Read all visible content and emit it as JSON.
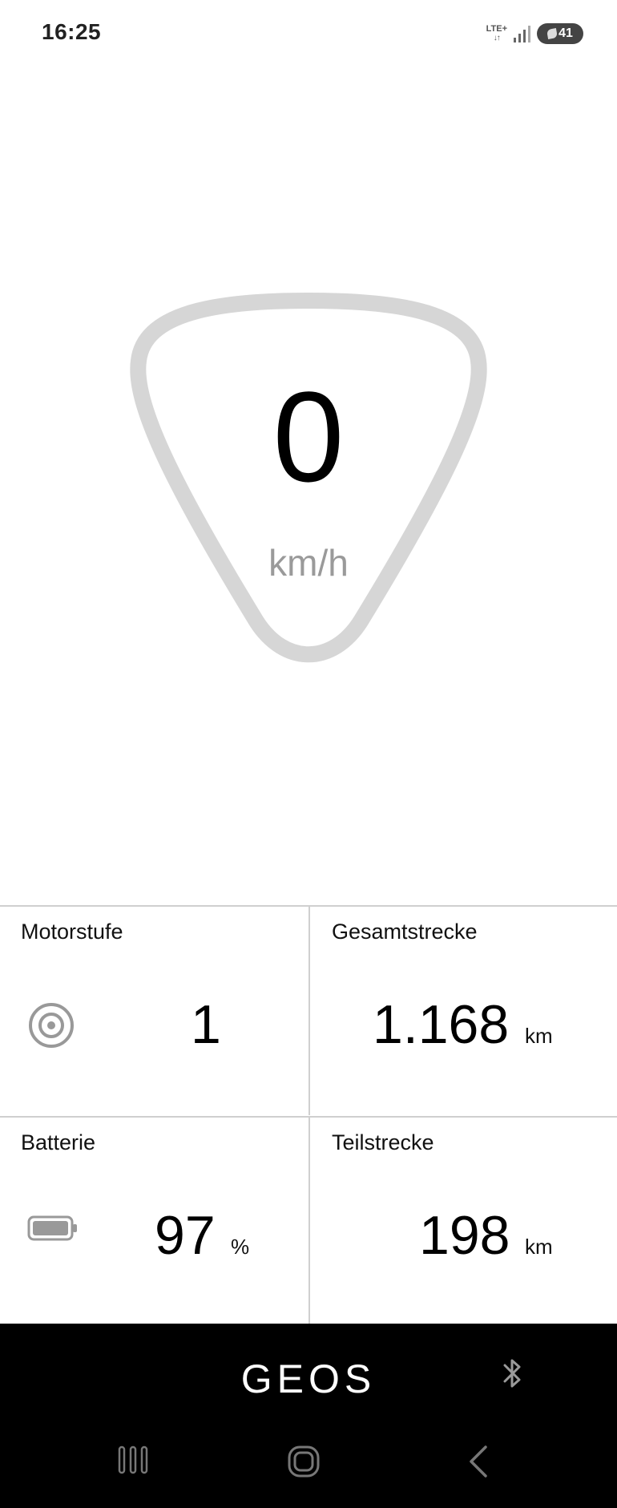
{
  "status_bar": {
    "time": "16:25",
    "network": "LTE+",
    "battery_level": "41"
  },
  "speedometer": {
    "value": "0",
    "unit": "km/h"
  },
  "tiles": {
    "motorstufe": {
      "label": "Motorstufe",
      "value": "1",
      "icon": "target-icon"
    },
    "gesamtstrecke": {
      "label": "Gesamtstrecke",
      "value": "1.168",
      "unit": "km"
    },
    "batterie": {
      "label": "Batterie",
      "value": "97",
      "unit": "%",
      "icon": "battery-icon"
    },
    "teilstrecke": {
      "label": "Teilstrecke",
      "value": "198",
      "unit": "km"
    }
  },
  "bottom_bar": {
    "brand": "GEOS",
    "bluetooth_icon": "bluetooth-icon"
  },
  "navigation": {
    "recent": "recent-apps-icon",
    "home": "home-icon",
    "back": "back-icon"
  }
}
